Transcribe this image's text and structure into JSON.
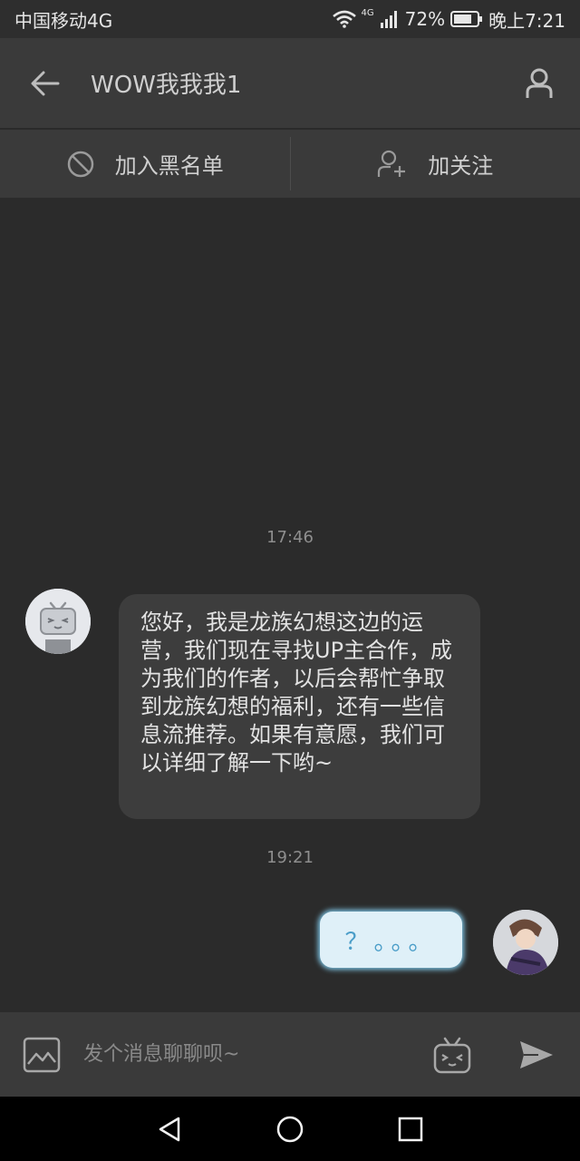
{
  "status_bar": {
    "carrier": "中国移动4G",
    "network_badge": "4G",
    "battery_percent": "72%",
    "time": "晚上7:21"
  },
  "header": {
    "title": "WOW我我我1",
    "back_icon": "back-arrow-icon",
    "profile_icon": "user-profile-icon"
  },
  "actions": {
    "blacklist_label": "加入黑名单",
    "follow_label": "加关注"
  },
  "messages": [
    {
      "time": "17:46",
      "direction": "incoming",
      "text": "您好，我是龙族幻想这边的运营，我们现在寻找UP主合作，成为我们的作者，以后会帮忙争取到龙族幻想的福利，还有一些信息流推荐。如果有意愿，我们可以详细了解一下哟~"
    },
    {
      "time": "19:21",
      "direction": "outgoing",
      "text": "？。。。"
    }
  ],
  "input": {
    "placeholder": "发个消息聊聊呗~"
  },
  "colors": {
    "background": "#2b2b2b",
    "bar": "#3a3a3a",
    "outgoing_bubble": "#dff0f8",
    "outgoing_glow": "#7fc6e6"
  }
}
